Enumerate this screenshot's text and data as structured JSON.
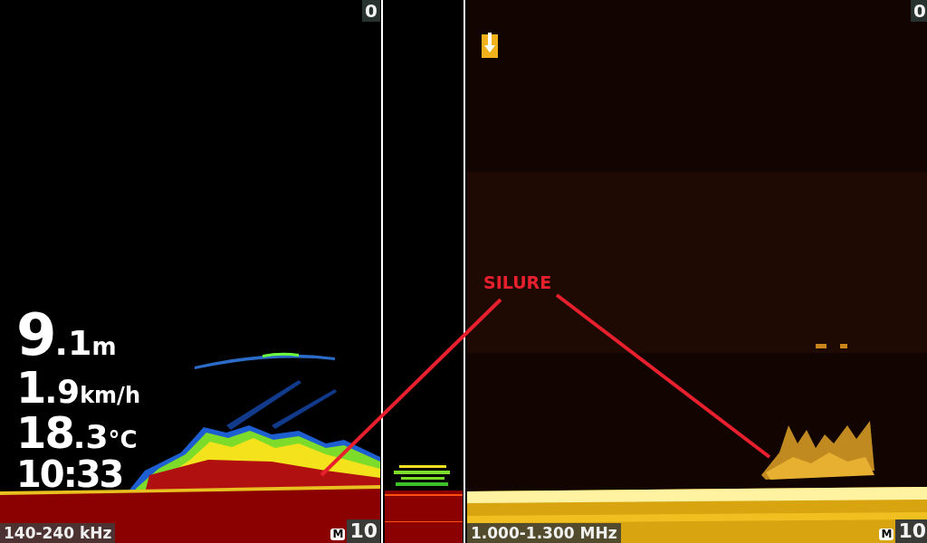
{
  "panes": [
    {
      "kind": "chirp",
      "top_depth": "0",
      "frequency": "140-240 kHz",
      "range_mode": "M",
      "bottom_depth": "10"
    },
    {
      "kind": "flasher"
    },
    {
      "kind": "downscan",
      "top_depth": "0",
      "frequency": "1.000-1.300 MHz",
      "range_mode": "M",
      "bottom_depth": "10",
      "marker": true
    }
  ],
  "readouts": [
    {
      "main": "9",
      "fraction": ".1",
      "unit": "m"
    },
    {
      "main": "1",
      "fraction": ".9",
      "unit": "km/h"
    },
    {
      "main": "18",
      "fraction": ".3",
      "unit": "°C"
    },
    {
      "main": "10:33"
    }
  ],
  "annotation": {
    "label": "SILURE"
  }
}
